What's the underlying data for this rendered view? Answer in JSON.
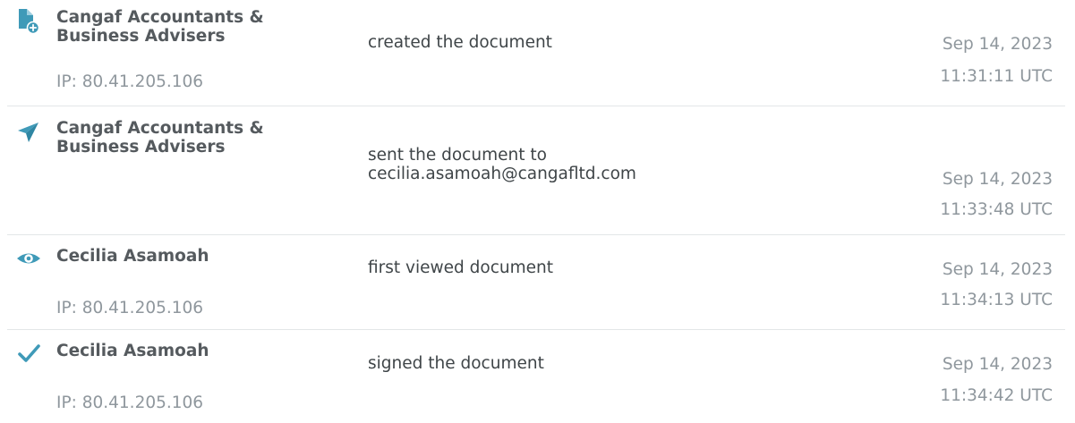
{
  "colors": {
    "accent": "#3f9ab8",
    "actor_text": "#555a5e",
    "muted_text": "#8f979d",
    "action_text": "#3f4548",
    "divider": "#e3e6e8"
  },
  "events": [
    {
      "icon": "document-add-icon",
      "actor": "Cangaf Accountants &\nBusiness Advisers",
      "ip": "IP: 80.41.205.106",
      "action": "created the document",
      "date": "Sep 14, 2023",
      "time": "11:31:11 UTC"
    },
    {
      "icon": "paper-plane-icon",
      "actor": "Cangaf Accountants &\nBusiness Advisers",
      "action": "sent the document to\ncecilia.asamoah@cangafltd.com",
      "date": "Sep 14, 2023",
      "time": "11:33:48 UTC"
    },
    {
      "icon": "eye-icon",
      "actor": "Cecilia Asamoah",
      "ip": "IP: 80.41.205.106",
      "action": "first viewed document",
      "date": "Sep 14, 2023",
      "time": "11:34:13 UTC"
    },
    {
      "icon": "checkmark-icon",
      "actor": "Cecilia Asamoah",
      "ip": "IP: 80.41.205.106",
      "action": "signed the document",
      "date": "Sep 14, 2023",
      "time": "11:34:42 UTC"
    }
  ]
}
